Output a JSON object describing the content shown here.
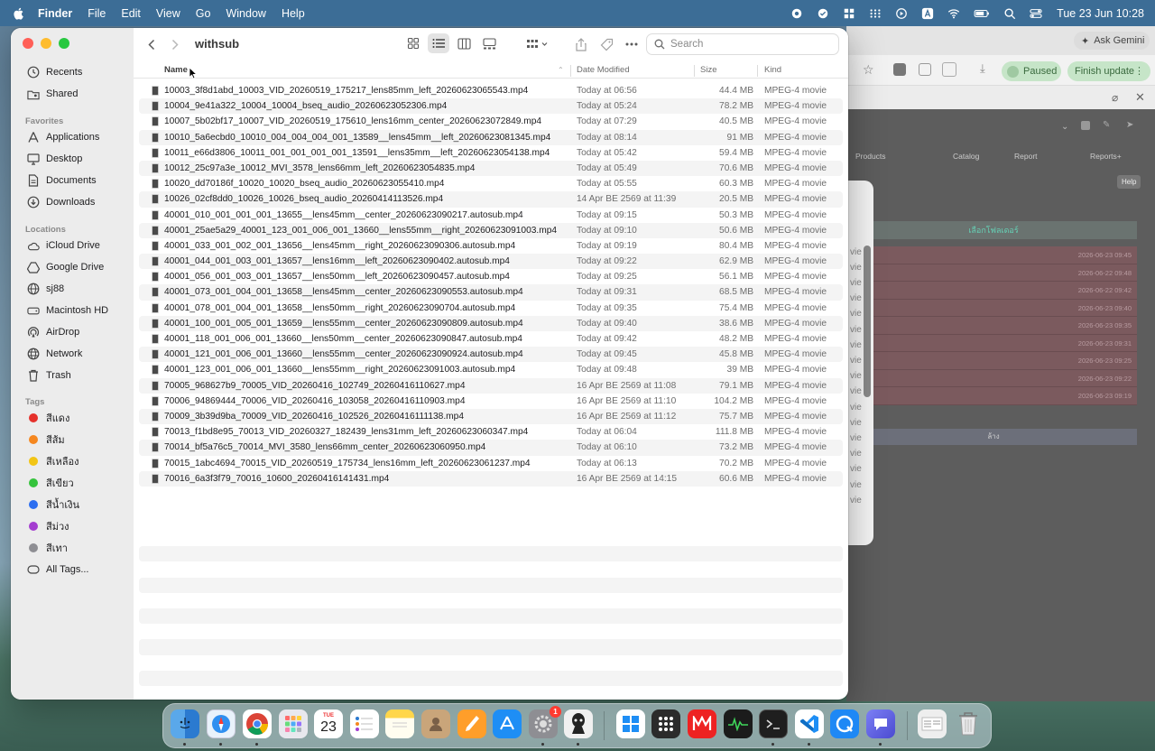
{
  "menubar": {
    "app_name": "Finder",
    "menus": [
      "File",
      "Edit",
      "View",
      "Go",
      "Window",
      "Help"
    ],
    "datetime": "Tue 23 Jun  10:28"
  },
  "browser": {
    "ask_gemini": "Ask Gemini",
    "paused": "Paused",
    "finish_update": "Finish update",
    "nav": [
      "Products",
      "Catalog",
      "Report",
      "Reports+"
    ],
    "help": "Help",
    "header": "เลือกโฟลเดอร์",
    "footer": "ล้าง",
    "row_dates": [
      "2026-06-23 09:45",
      "2026-06-22 09:48",
      "2026-06-22 09:42",
      "2026-06-23 09:40",
      "2026-06-23 09:35",
      "2026-06-23 09:31",
      "2026-06-23 09:25",
      "2026-06-23 09:22",
      "2026-06-23 09:19"
    ],
    "panel_items": [
      "vie",
      "vie",
      "vie",
      "vie",
      "vie",
      "vie",
      "vie",
      "vie",
      "vie",
      "vie",
      "vie",
      "vie",
      "vie",
      "vie",
      "vie",
      "vie",
      "vie",
      "vie"
    ]
  },
  "finder": {
    "title": "withsub",
    "search_placeholder": "Search",
    "columns": {
      "name": "Name",
      "date": "Date Modified",
      "size": "Size",
      "kind": "Kind"
    },
    "sidebar": {
      "items_top": [
        {
          "label": "Recents",
          "icon": "clock-icon"
        },
        {
          "label": "Shared",
          "icon": "shared-folder-icon"
        }
      ],
      "favorites_title": "Favorites",
      "favorites": [
        {
          "label": "Applications",
          "icon": "applications-icon"
        },
        {
          "label": "Desktop",
          "icon": "desktop-icon"
        },
        {
          "label": "Documents",
          "icon": "document-icon"
        },
        {
          "label": "Downloads",
          "icon": "download-icon"
        }
      ],
      "locations_title": "Locations",
      "locations": [
        {
          "label": "iCloud Drive",
          "icon": "cloud-icon"
        },
        {
          "label": "Google Drive",
          "icon": "drive-icon"
        },
        {
          "label": "sj88",
          "icon": "globe-icon"
        },
        {
          "label": "Macintosh HD",
          "icon": "disk-icon"
        },
        {
          "label": "AirDrop",
          "icon": "airdrop-icon"
        },
        {
          "label": "Network",
          "icon": "network-icon"
        },
        {
          "label": "Trash",
          "icon": "trash-icon"
        }
      ],
      "tags_title": "Tags",
      "tags": [
        {
          "label": "สีแดง",
          "color": "#e5302b"
        },
        {
          "label": "สีส้ม",
          "color": "#f5871f"
        },
        {
          "label": "สีเหลือง",
          "color": "#f2c515"
        },
        {
          "label": "สีเขียว",
          "color": "#35c33c"
        },
        {
          "label": "สีน้ำเงิน",
          "color": "#2b6ef0"
        },
        {
          "label": "สีม่วง",
          "color": "#a43dd0"
        },
        {
          "label": "สีเทา",
          "color": "#8e8e93"
        }
      ],
      "all_tags": "All Tags..."
    },
    "files": [
      {
        "name": "10003_3f8d1abd_10003_VID_20260519_175217_lens85mm_left_20260623065543.mp4",
        "date": "Today at 06:56",
        "size": "44.4 MB",
        "kind": "MPEG-4 movie"
      },
      {
        "name": "10004_9e41a322_10004_10004_bseq_audio_20260623052306.mp4",
        "date": "Today at 05:24",
        "size": "78.2 MB",
        "kind": "MPEG-4 movie"
      },
      {
        "name": "10007_5b02bf17_10007_VID_20260519_175610_lens16mm_center_20260623072849.mp4",
        "date": "Today at 07:29",
        "size": "40.5 MB",
        "kind": "MPEG-4 movie"
      },
      {
        "name": "10010_5a6ecbd0_10010_004_004_004_001_13589__lens45mm__left_20260623081345.mp4",
        "date": "Today at 08:14",
        "size": "91 MB",
        "kind": "MPEG-4 movie"
      },
      {
        "name": "10011_e66d3806_10011_001_001_001_001_13591__lens35mm__left_20260623054138.mp4",
        "date": "Today at 05:42",
        "size": "59.4 MB",
        "kind": "MPEG-4 movie"
      },
      {
        "name": "10012_25c97a3e_10012_MVI_3578_lens66mm_left_20260623054835.mp4",
        "date": "Today at 05:49",
        "size": "70.6 MB",
        "kind": "MPEG-4 movie"
      },
      {
        "name": "10020_dd70186f_10020_10020_bseq_audio_20260623055410.mp4",
        "date": "Today at 05:55",
        "size": "60.3 MB",
        "kind": "MPEG-4 movie"
      },
      {
        "name": "10026_02cf8dd0_10026_10026_bseq_audio_20260414113526.mp4",
        "date": "14 Apr BE 2569 at 11:39",
        "size": "20.5 MB",
        "kind": "MPEG-4 movie"
      },
      {
        "name": "40001_010_001_001_001_13655__lens45mm__center_20260623090217.autosub.mp4",
        "date": "Today at 09:15",
        "size": "50.3 MB",
        "kind": "MPEG-4 movie"
      },
      {
        "name": "40001_25ae5a29_40001_123_001_006_001_13660__lens55mm__right_20260623091003.mp4",
        "date": "Today at 09:10",
        "size": "50.6 MB",
        "kind": "MPEG-4 movie"
      },
      {
        "name": "40001_033_001_002_001_13656__lens45mm__right_20260623090306.autosub.mp4",
        "date": "Today at 09:19",
        "size": "80.4 MB",
        "kind": "MPEG-4 movie"
      },
      {
        "name": "40001_044_001_003_001_13657__lens16mm__left_20260623090402.autosub.mp4",
        "date": "Today at 09:22",
        "size": "62.9 MB",
        "kind": "MPEG-4 movie"
      },
      {
        "name": "40001_056_001_003_001_13657__lens50mm__left_20260623090457.autosub.mp4",
        "date": "Today at 09:25",
        "size": "56.1 MB",
        "kind": "MPEG-4 movie"
      },
      {
        "name": "40001_073_001_004_001_13658__lens45mm__center_20260623090553.autosub.mp4",
        "date": "Today at 09:31",
        "size": "68.5 MB",
        "kind": "MPEG-4 movie"
      },
      {
        "name": "40001_078_001_004_001_13658__lens50mm__right_20260623090704.autosub.mp4",
        "date": "Today at 09:35",
        "size": "75.4 MB",
        "kind": "MPEG-4 movie"
      },
      {
        "name": "40001_100_001_005_001_13659__lens55mm__center_20260623090809.autosub.mp4",
        "date": "Today at 09:40",
        "size": "38.6 MB",
        "kind": "MPEG-4 movie"
      },
      {
        "name": "40001_118_001_006_001_13660__lens50mm__center_20260623090847.autosub.mp4",
        "date": "Today at 09:42",
        "size": "48.2 MB",
        "kind": "MPEG-4 movie"
      },
      {
        "name": "40001_121_001_006_001_13660__lens55mm__center_20260623090924.autosub.mp4",
        "date": "Today at 09:45",
        "size": "45.8 MB",
        "kind": "MPEG-4 movie"
      },
      {
        "name": "40001_123_001_006_001_13660__lens55mm__right_20260623091003.autosub.mp4",
        "date": "Today at 09:48",
        "size": "39 MB",
        "kind": "MPEG-4 movie"
      },
      {
        "name": "70005_968627b9_70005_VID_20260416_102749_20260416110627.mp4",
        "date": "16 Apr BE 2569 at 11:08",
        "size": "79.1 MB",
        "kind": "MPEG-4 movie"
      },
      {
        "name": "70006_94869444_70006_VID_20260416_103058_20260416110903.mp4",
        "date": "16 Apr BE 2569 at 11:10",
        "size": "104.2 MB",
        "kind": "MPEG-4 movie"
      },
      {
        "name": "70009_3b39d9ba_70009_VID_20260416_102526_20260416111138.mp4",
        "date": "16 Apr BE 2569 at 11:12",
        "size": "75.7 MB",
        "kind": "MPEG-4 movie"
      },
      {
        "name": "70013_f1bd8e95_70013_VID_20260327_182439_lens31mm_left_20260623060347.mp4",
        "date": "Today at 06:04",
        "size": "111.8 MB",
        "kind": "MPEG-4 movie"
      },
      {
        "name": "70014_bf5a76c5_70014_MVI_3580_lens66mm_center_20260623060950.mp4",
        "date": "Today at 06:10",
        "size": "73.2 MB",
        "kind": "MPEG-4 movie"
      },
      {
        "name": "70015_1abc4694_70015_VID_20260519_175734_lens16mm_left_20260623061237.mp4",
        "date": "Today at 06:13",
        "size": "70.2 MB",
        "kind": "MPEG-4 movie"
      },
      {
        "name": "70016_6a3f3f79_70016_10600_20260416141431.mp4",
        "date": "16 Apr BE 2569 at 14:15",
        "size": "60.6 MB",
        "kind": "MPEG-4 movie"
      }
    ]
  },
  "dock": {
    "calendar_month": "TUE",
    "calendar_day": "23",
    "settings_badge": "1",
    "apps": [
      "finder-icon",
      "safari-icon",
      "chrome-icon",
      "launchpad-icon",
      "calendar-icon",
      "reminders-icon",
      "notes-icon",
      "contacts-icon",
      "pages-icon",
      "app-store-icon",
      "system-settings-icon",
      "photo-app-icon",
      "windows-app-icon",
      "grid-app-icon",
      "media-app-icon",
      "activity-monitor-icon",
      "terminal-icon",
      "vscode-icon",
      "quick-app-icon",
      "chat-app-icon",
      "preview-icon",
      "dock-trash-icon"
    ]
  }
}
